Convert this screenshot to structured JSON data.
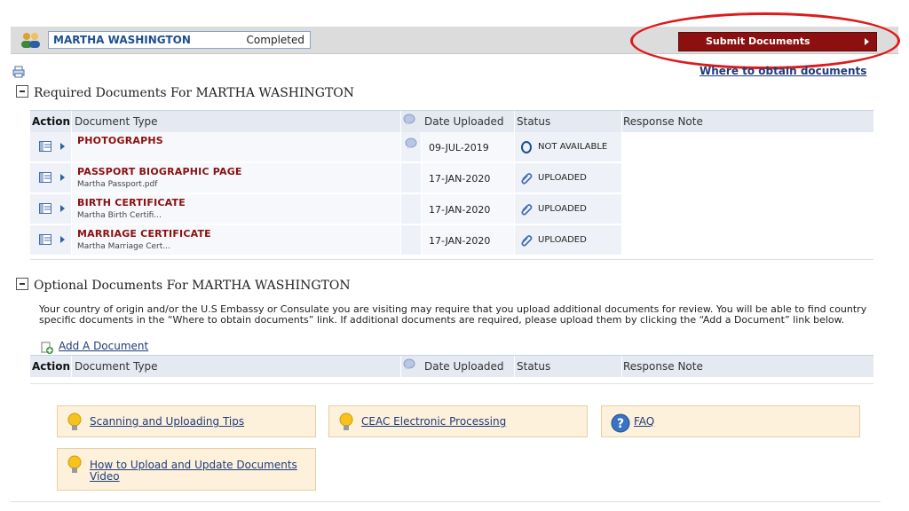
{
  "applicant": {
    "name": "MARTHA WASHINGTON",
    "status": "Completed"
  },
  "toolbar": {
    "submit_label": "Submit Documents",
    "where_link": "Where to obtain documents"
  },
  "required": {
    "title": "Required Documents For MARTHA WASHINGTON",
    "headers": {
      "action": "Action",
      "type": "Document Type",
      "date": "Date Uploaded",
      "status": "Status",
      "response": "Response Note"
    },
    "rows": [
      {
        "title": "PHOTOGRAPHS",
        "file": "",
        "date": "09-JUL-2019",
        "status": "NOT AVAILABLE",
        "status_icon": "circle-o-icon",
        "has_note": true
      },
      {
        "title": "PASSPORT BIOGRAPHIC PAGE",
        "file": "Martha Passport.pdf",
        "date": "17-JAN-2020",
        "status": "UPLOADED",
        "status_icon": "paperclip-icon",
        "has_note": false
      },
      {
        "title": "BIRTH CERTIFICATE",
        "file": "Martha Birth Certifi...",
        "date": "17-JAN-2020",
        "status": "UPLOADED",
        "status_icon": "paperclip-icon",
        "has_note": false
      },
      {
        "title": "MARRIAGE CERTIFICATE",
        "file": "Martha Marriage Cert...",
        "date": "17-JAN-2020",
        "status": "UPLOADED",
        "status_icon": "paperclip-icon",
        "has_note": false
      }
    ]
  },
  "optional": {
    "title": "Optional Documents For MARTHA WASHINGTON",
    "description": "Your country of origin and/or the U.S Embassy or Consulate you are visiting may require that you upload additional documents for review. You will be able to find country specific documents in the “Where to obtain documents” link. If additional documents are required, please upload them by clicking the “Add a Document” link below.",
    "add_link": "Add A Document",
    "headers": {
      "action": "Action",
      "type": "Document Type",
      "date": "Date Uploaded",
      "status": "Status",
      "response": "Response Note"
    }
  },
  "help": {
    "scanning": "Scanning and Uploading Tips",
    "ceac": "CEAC Electronic Processing",
    "faq": "FAQ",
    "howto_line1": "How to Upload and Update Documents",
    "howto_line2": "Video"
  },
  "colors": {
    "accent_red": "#8c1010",
    "link_blue": "#1f3c7a",
    "header_bg": "#e4e9f2",
    "help_bg": "#fdf1dc",
    "highlight": "#e01a1a"
  }
}
